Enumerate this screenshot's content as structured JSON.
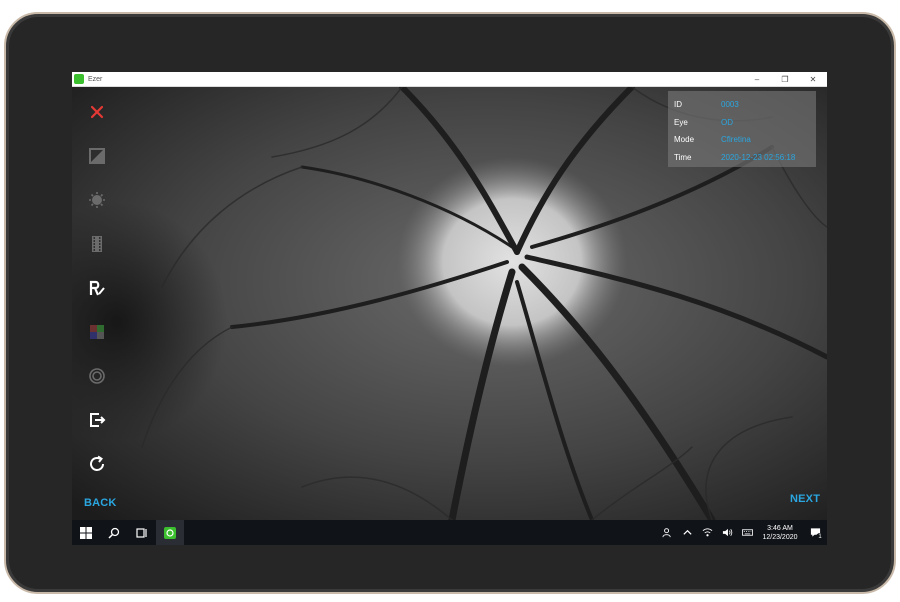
{
  "window": {
    "title": "Ezer",
    "minimize_glyph": "–",
    "maximize_glyph": "❐",
    "close_glyph": "✕"
  },
  "sidebar": {
    "items": [
      {
        "name": "close-icon",
        "color": "#e53935"
      },
      {
        "name": "contrast-icon",
        "color": "#6b6b6b"
      },
      {
        "name": "brightness-icon",
        "color": "#6b6b6b"
      },
      {
        "name": "film-strip-icon",
        "color": "#6b6b6b"
      },
      {
        "name": "annotate-icon",
        "color": "#ffffff"
      },
      {
        "name": "color-channel-icon",
        "color": "#6b6b6b"
      },
      {
        "name": "target-ring-icon",
        "color": "#6b6b6b"
      },
      {
        "name": "export-icon",
        "color": "#ffffff"
      },
      {
        "name": "refresh-icon",
        "color": "#ffffff"
      }
    ]
  },
  "nav": {
    "back": "BACK",
    "next": "NEXT"
  },
  "info": {
    "rows": [
      {
        "label": "ID",
        "value": "0003"
      },
      {
        "label": "Eye",
        "value": "OD"
      },
      {
        "label": "Mode",
        "value": "Cflretina"
      },
      {
        "label": "Time",
        "value": "2020-12-23 02:56:18"
      }
    ]
  },
  "taskbar": {
    "clock_time": "3:46 AM",
    "clock_date": "12/23/2020",
    "notification_count": "1",
    "icons": [
      "windows-start-icon",
      "search-icon",
      "task-view-icon",
      "ezer-app-icon"
    ],
    "tray_icons": [
      "people-icon",
      "chevron-up-icon",
      "network-icon",
      "volume-icon",
      "keyboard-icon"
    ]
  },
  "colors": {
    "accent": "#2aa6e0",
    "close": "#e53935",
    "app_icon": "#3cbf2e"
  }
}
